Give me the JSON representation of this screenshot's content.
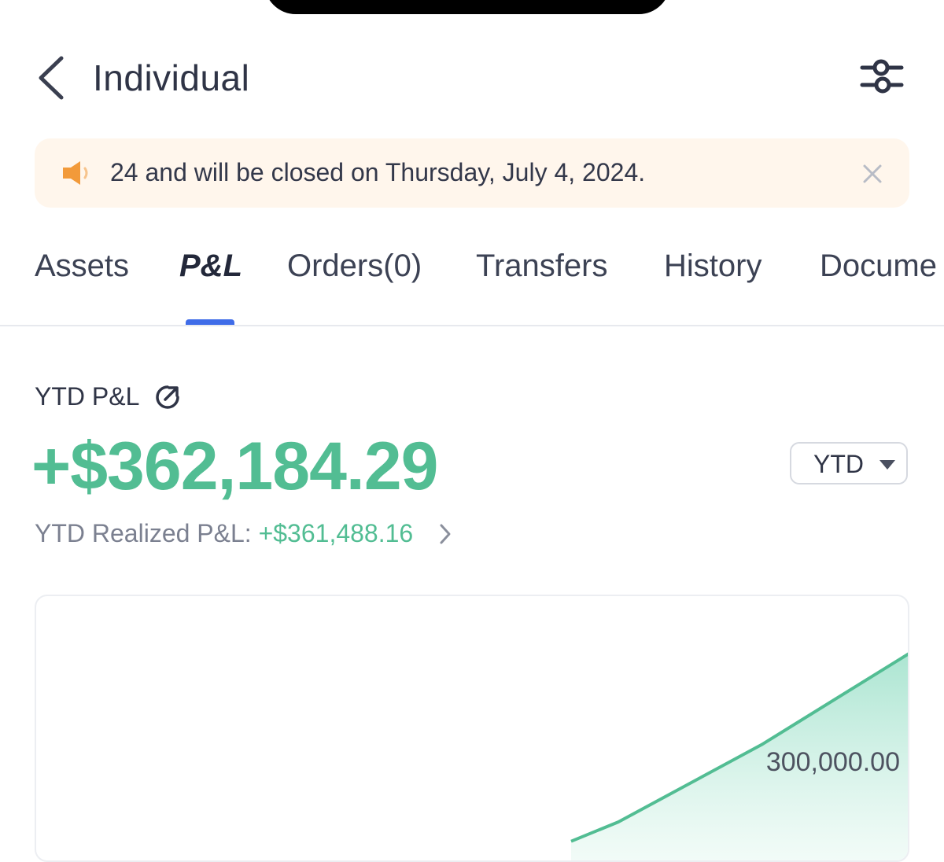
{
  "header": {
    "title": "Individual",
    "back_icon": "chevron-left-icon",
    "filter_icon": "sliders-icon"
  },
  "banner": {
    "icon": "speaker-icon",
    "text": "24 and will be closed on Thursday, July 4, 2024.",
    "close_icon": "close-icon"
  },
  "tabs": [
    {
      "label": "Assets"
    },
    {
      "label": "P&L",
      "active": true
    },
    {
      "label": "Orders(0)"
    },
    {
      "label": "Transfers"
    },
    {
      "label": "History"
    },
    {
      "label": "Docume"
    }
  ],
  "pnl": {
    "label": "YTD P&L",
    "share_icon": "share-icon",
    "total": "+$362,184.29",
    "period": "YTD",
    "realized_label": "YTD Realized P&L: ",
    "realized_value": "+$361,488.16"
  },
  "colors": {
    "positive": "#52bd93",
    "accent": "#3f6ce8",
    "banner_bg": "#fff6ec"
  },
  "chart_data": {
    "type": "area",
    "reference_label": "300,000.00",
    "reference_value": 300000,
    "series": [
      {
        "values": [
          235000,
          248000,
          300000,
          362184.29
        ]
      }
    ],
    "ylim": [
      220000,
      400000
    ],
    "grid": false
  }
}
